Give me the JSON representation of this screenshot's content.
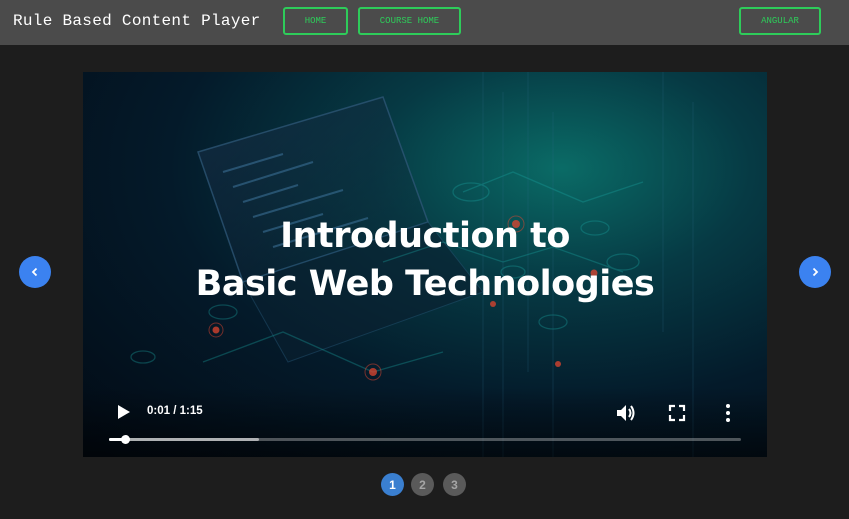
{
  "header": {
    "title": "Rule Based Content Player",
    "nav": [
      {
        "label": "HOME"
      },
      {
        "label": "COURSE HOME"
      },
      {
        "label": "ANGULAR"
      }
    ]
  },
  "video": {
    "title_line1": "Introduction to",
    "title_line2": "Basic Web Technologies",
    "time": "0:01 / 1:15",
    "played_fraction": 0.025,
    "buffered_fraction": 0.237
  },
  "carousel": {
    "prev_icon": "chevron-left-icon",
    "next_icon": "chevron-right-icon",
    "pages": [
      {
        "label": "1",
        "active": true
      },
      {
        "label": "2",
        "active": false
      },
      {
        "label": "3",
        "active": false
      }
    ]
  },
  "colors": {
    "accent_green": "#2ecc5a",
    "accent_blue": "#3b82f0",
    "header_bg": "#4b4b4b"
  }
}
